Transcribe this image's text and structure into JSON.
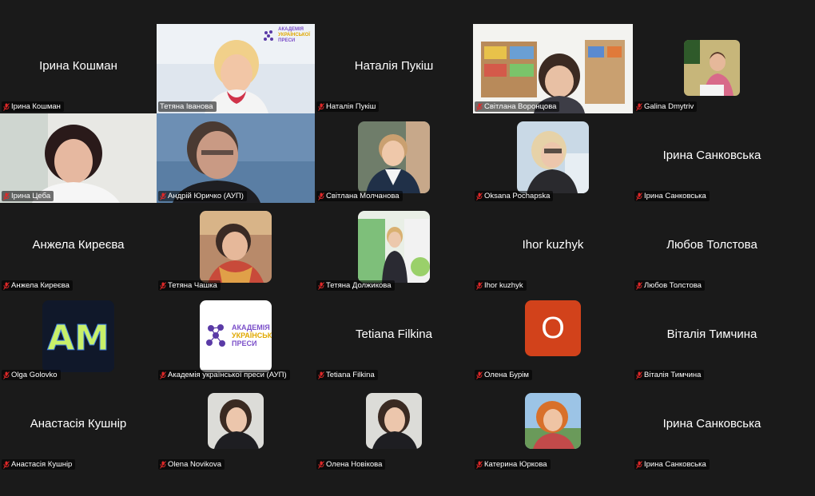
{
  "meeting": {
    "accent_active": "#35c552",
    "muted_icon_color": "#e02828",
    "mic_icon": "muted-mic-icon"
  },
  "participants": [
    {
      "name": "Ірина Кошман",
      "big": "Ірина Кошман",
      "kind": "name"
    },
    {
      "name": "Тетяна Іванова",
      "kind": "video",
      "active": true
    },
    {
      "name": "Наталія Пукіш",
      "big": "Наталія Пукіш",
      "kind": "name"
    },
    {
      "name": "Світлана Воронцова",
      "kind": "video"
    },
    {
      "name": "Galina Dmytriv",
      "kind": "avatar"
    },
    {
      "name": "Ірина Цеба",
      "kind": "video"
    },
    {
      "name": "Андрій Юричко (АУП)",
      "kind": "video"
    },
    {
      "name": "Світлана Молчанова",
      "kind": "avatar"
    },
    {
      "name": "Oksana Pochapska",
      "kind": "avatar"
    },
    {
      "name": "Ірина Санковська",
      "big": "Ірина Санковська",
      "kind": "name"
    },
    {
      "name": "Анжела Киреєва",
      "big": "Анжела Киреєва",
      "kind": "name"
    },
    {
      "name": "Тетяна Чашка",
      "kind": "avatar"
    },
    {
      "name": "Тетяна Должикова",
      "kind": "avatar"
    },
    {
      "name": "Ihor kuzhyk",
      "big": "Ihor kuzhyk",
      "kind": "name"
    },
    {
      "name": "Любов Толстова",
      "big": "Любов Толстова",
      "kind": "name"
    },
    {
      "name": "Olga Golovko",
      "kind": "avatar"
    },
    {
      "name": "Академія української преси (АУП)",
      "kind": "avatar"
    },
    {
      "name": "Tetiana Filkina",
      "big": "Tetiana Filkina",
      "kind": "name"
    },
    {
      "name": "Олена Бурім",
      "kind": "avatar",
      "letter": "O"
    },
    {
      "name": "Віталія Тимчина",
      "big": "Віталія Тимчина",
      "kind": "name"
    },
    {
      "name": "Анастасія Кушнір",
      "big": "Анастасія Кушнір",
      "kind": "name"
    },
    {
      "name": "Olena Novikova",
      "kind": "avatar"
    },
    {
      "name": "Олена Новікова",
      "kind": "avatar"
    },
    {
      "name": "Катерина Юркова",
      "kind": "avatar"
    },
    {
      "name": "Ірина Санковська",
      "big": "Ірина Санковська",
      "kind": "name"
    }
  ],
  "logo": {
    "line1": "АКАДЕМІЯ",
    "line2": "УКРАЇНСЬКОЇ",
    "line3": "ПРЕСИ"
  },
  "am_logo": "AM"
}
